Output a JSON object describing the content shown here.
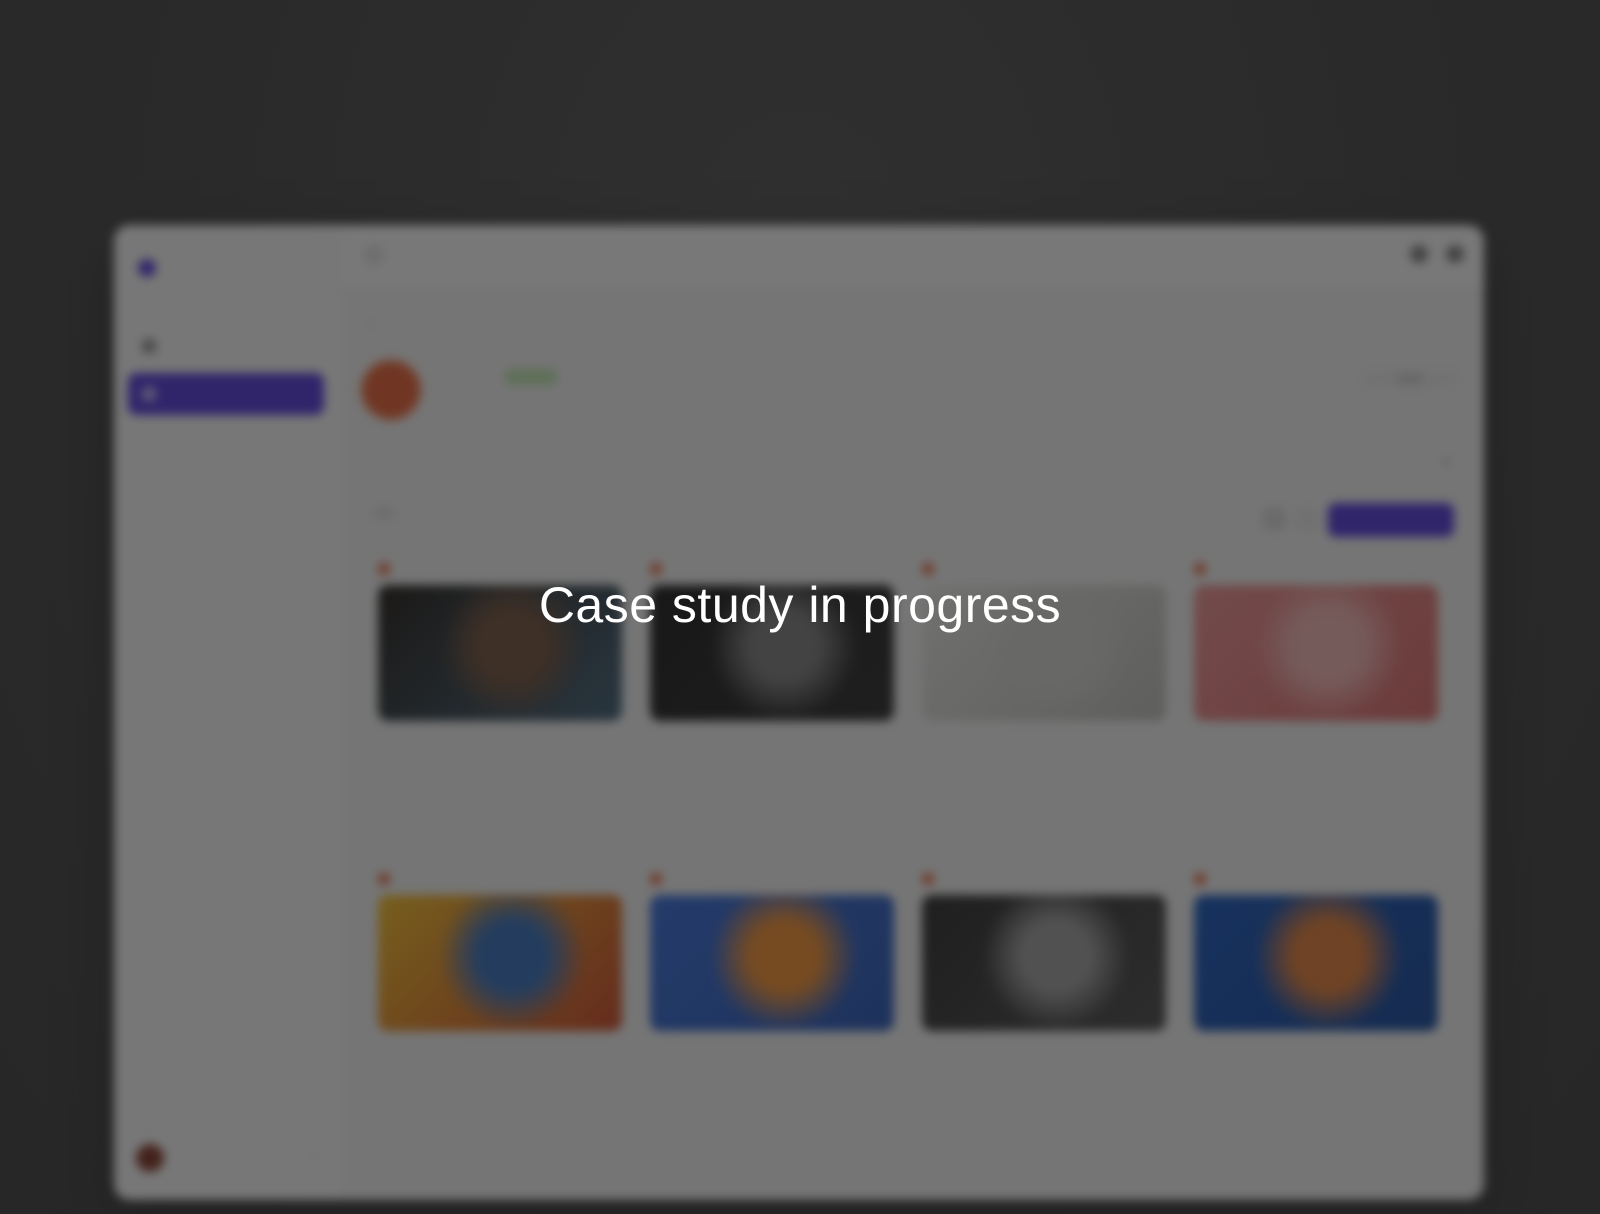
{
  "overlay": {
    "message": "Case study in progress"
  },
  "app": {
    "brand": "",
    "search_placeholder": "",
    "sidebar": {
      "items": [
        {
          "label": "",
          "active": false
        },
        {
          "label": "",
          "active": true
        }
      ],
      "user": {
        "name": "",
        "email": ""
      }
    },
    "profile": {
      "back_label": "",
      "name": "",
      "badge": "",
      "subtitle": ""
    },
    "segments": [
      "",
      "",
      ""
    ],
    "tabs": [
      "",
      ""
    ],
    "filter_label": "",
    "sub_tabs": [
      "",
      ""
    ],
    "primary_action": "",
    "cards": [
      {
        "thumb": "portrait-dark",
        "colors": [
          "#1a1410",
          "#6b4a34",
          "#3a5a70"
        ]
      },
      {
        "thumb": "bw-face",
        "colors": [
          "#111111",
          "#777777",
          "#222222"
        ]
      },
      {
        "thumb": "sketch-light",
        "colors": [
          "#e4e4e0",
          "#cfcfcb",
          "#b8b8b4"
        ]
      },
      {
        "thumb": "pink-red",
        "colors": [
          "#e88a8a",
          "#f0b0b0",
          "#d86464"
        ]
      },
      {
        "thumb": "yellow-blue",
        "colors": [
          "#f2b81e",
          "#2e6ab8",
          "#c8401e"
        ]
      },
      {
        "thumb": "blue-orange",
        "colors": [
          "#2f66d6",
          "#f08a2a",
          "#1f4fb0"
        ]
      },
      {
        "thumb": "bw-scene",
        "colors": [
          "#222222",
          "#9a9a9a",
          "#444444"
        ]
      },
      {
        "thumb": "blue-figure",
        "colors": [
          "#0f4fb8",
          "#e07830",
          "#0c3f96"
        ]
      }
    ],
    "colors": {
      "accent": "#4b2fd6",
      "overlay": "#1e1e1e"
    }
  }
}
